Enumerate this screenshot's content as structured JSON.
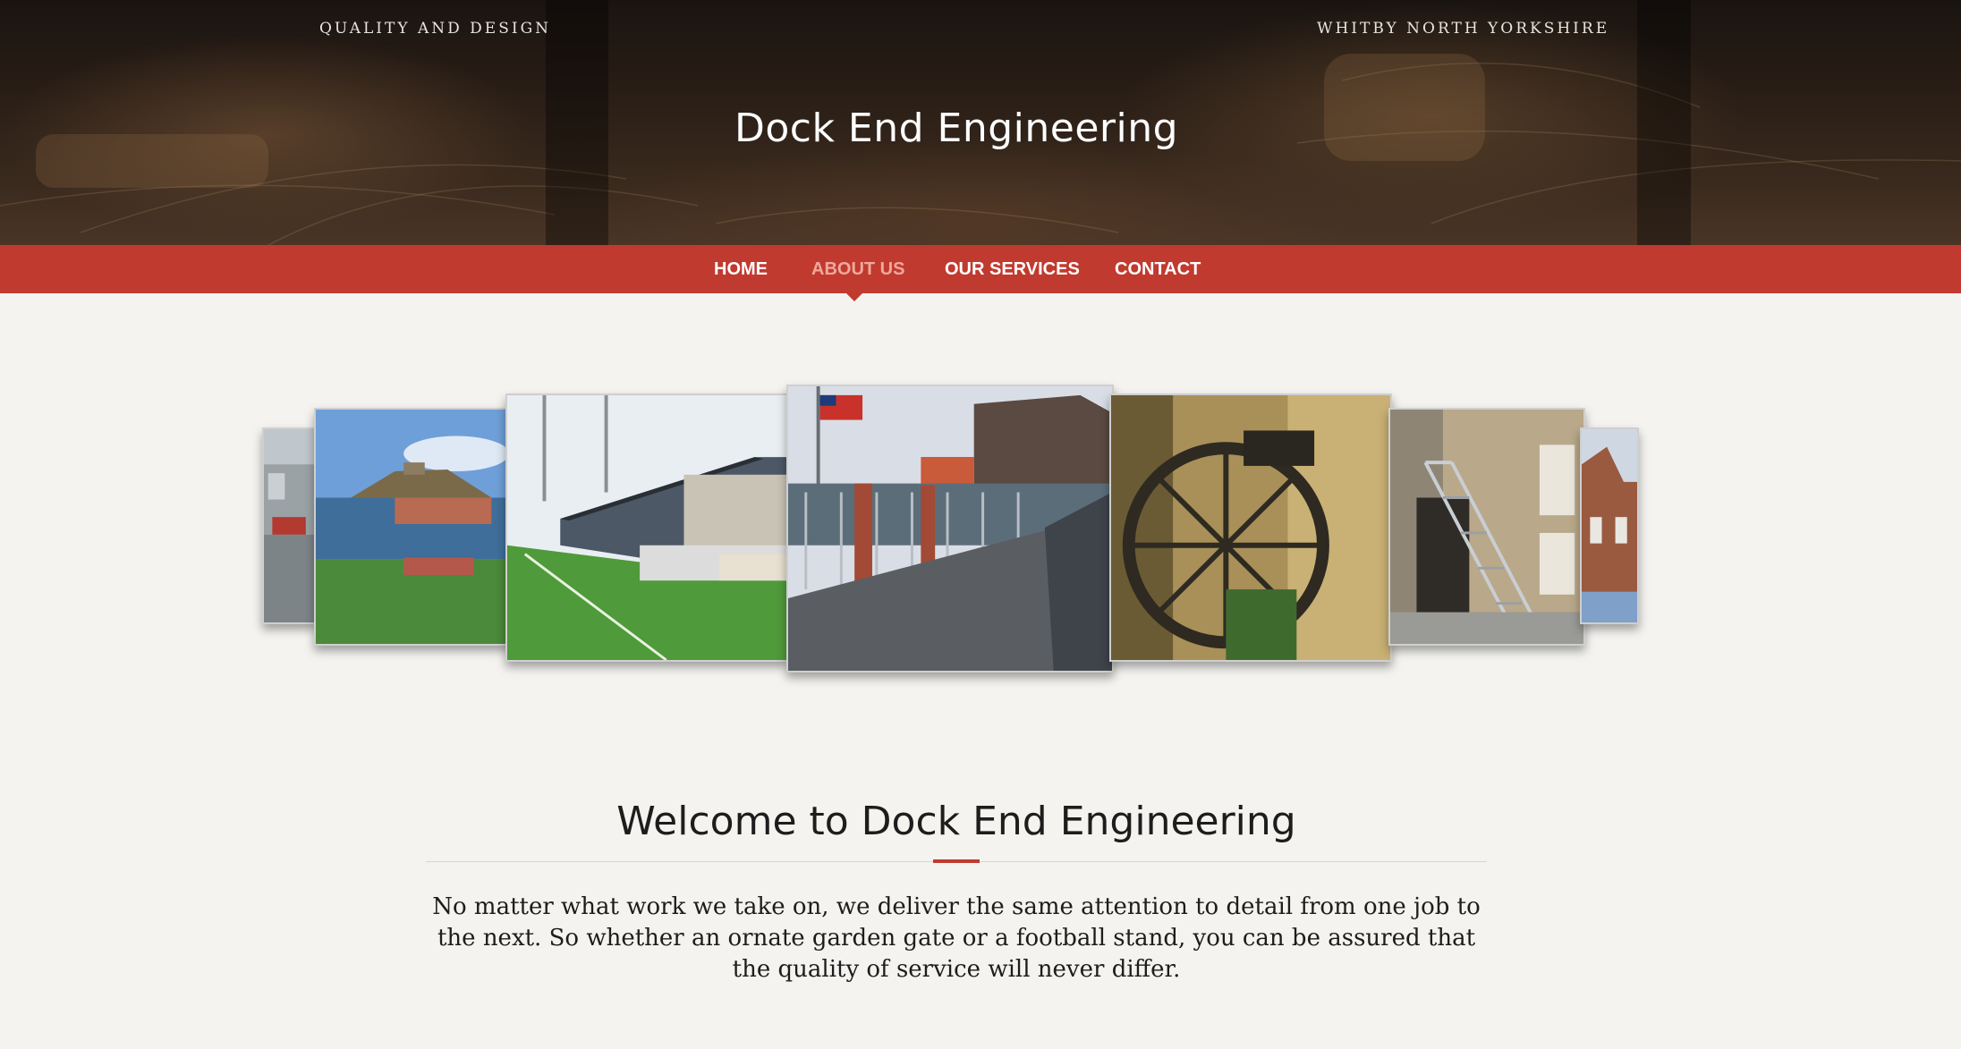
{
  "header": {
    "tagline_left": "QUALITY AND DESIGN",
    "tagline_right": "WHITBY NORTH YORKSHIRE",
    "site_title": "Dock End Engineering"
  },
  "nav": {
    "items": [
      {
        "label": "HOME",
        "active": false
      },
      {
        "label": "ABOUT US",
        "active": true
      },
      {
        "label": "OUR SERVICES",
        "active": false
      },
      {
        "label": "CONTACT",
        "active": false
      }
    ]
  },
  "carousel": {
    "slides": [
      {
        "subject": "whitby-street"
      },
      {
        "subject": "whitby-abbey-harbour"
      },
      {
        "subject": "football-stand"
      },
      {
        "subject": "railings-red-ensign"
      },
      {
        "subject": "waterwheel"
      },
      {
        "subject": "metal-staircase"
      },
      {
        "subject": "brick-building"
      }
    ]
  },
  "main": {
    "heading": "Welcome to Dock End Engineering",
    "intro": "No matter what work we take on, we deliver the same attention to detail from one job to the next. So whether an ornate garden gate or a football stand, you can be assured that the quality of service will never differ."
  },
  "colors": {
    "accent": "#c13a2f",
    "active_nav": "#f0a89c",
    "background": "#f4f3f0"
  }
}
